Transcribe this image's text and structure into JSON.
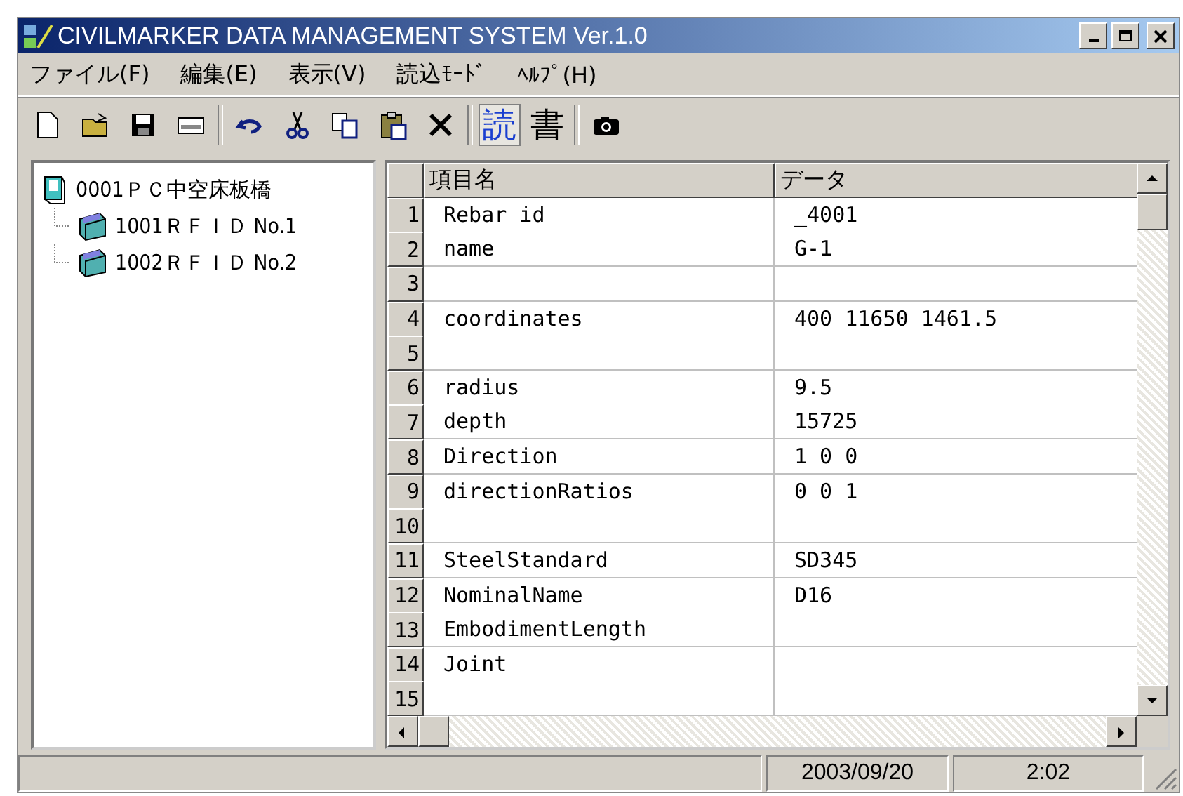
{
  "window": {
    "title": "CIVILMARKER DATA MANAGEMENT SYSTEM Ver.1.0"
  },
  "menu": [
    "ファイル(F)",
    "編集(E)",
    "表示(V)",
    "読込ﾓｰﾄﾞ",
    "ﾍﾙﾌﾟ(H)"
  ],
  "toolbar": [
    {
      "kind": "icon"
    },
    {
      "kind": "icon"
    },
    {
      "kind": "icon"
    },
    {
      "kind": "icon"
    },
    {
      "kind": "sep"
    },
    {
      "kind": "icon"
    },
    {
      "kind": "icon"
    },
    {
      "kind": "icon"
    },
    {
      "kind": "icon"
    },
    {
      "kind": "icon"
    },
    {
      "kind": "sep"
    },
    {
      "kind": "text",
      "label": "読",
      "selected": true
    },
    {
      "kind": "text",
      "label": "書",
      "selected": false
    },
    {
      "kind": "sep"
    },
    {
      "kind": "icon"
    }
  ],
  "tree": {
    "label": "0001ＰＣ中空床板橋",
    "children": [
      {
        "label": "1001ＲＦＩＤ No.1"
      },
      {
        "label": "1002ＲＦＩＤ No.2"
      }
    ]
  },
  "table": {
    "columns": [
      "項目名",
      "データ"
    ],
    "rows": [
      {
        "num": "1",
        "item": "Rebar id",
        "data": "_4001"
      },
      {
        "num": "2",
        "item": "name",
        "data": "G-1"
      },
      {
        "num": "3",
        "item": "",
        "data": ""
      },
      {
        "num": "4",
        "item": "coordinates",
        "data": "400 11650 1461.5"
      },
      {
        "num": "5",
        "item": "",
        "data": ""
      },
      {
        "num": "6",
        "item": "radius",
        "data": "9.5"
      },
      {
        "num": "7",
        "item": "depth",
        "data": "15725"
      },
      {
        "num": "8",
        "item": "Direction",
        "data": "1 0 0"
      },
      {
        "num": "9",
        "item": "directionRatios",
        "data": "0 0 1"
      },
      {
        "num": "10",
        "item": "",
        "data": ""
      },
      {
        "num": "11",
        "item": "SteelStandard",
        "data": "SD345"
      },
      {
        "num": "12",
        "item": "NominalName",
        "data": "D16"
      },
      {
        "num": "13",
        "item": "EmbodimentLength",
        "data": ""
      },
      {
        "num": "14",
        "item": "Joint",
        "data": ""
      },
      {
        "num": "15",
        "item": "",
        "data": ""
      }
    ]
  },
  "status_bar": {
    "date": "2003/09/20",
    "time": "2:02"
  }
}
